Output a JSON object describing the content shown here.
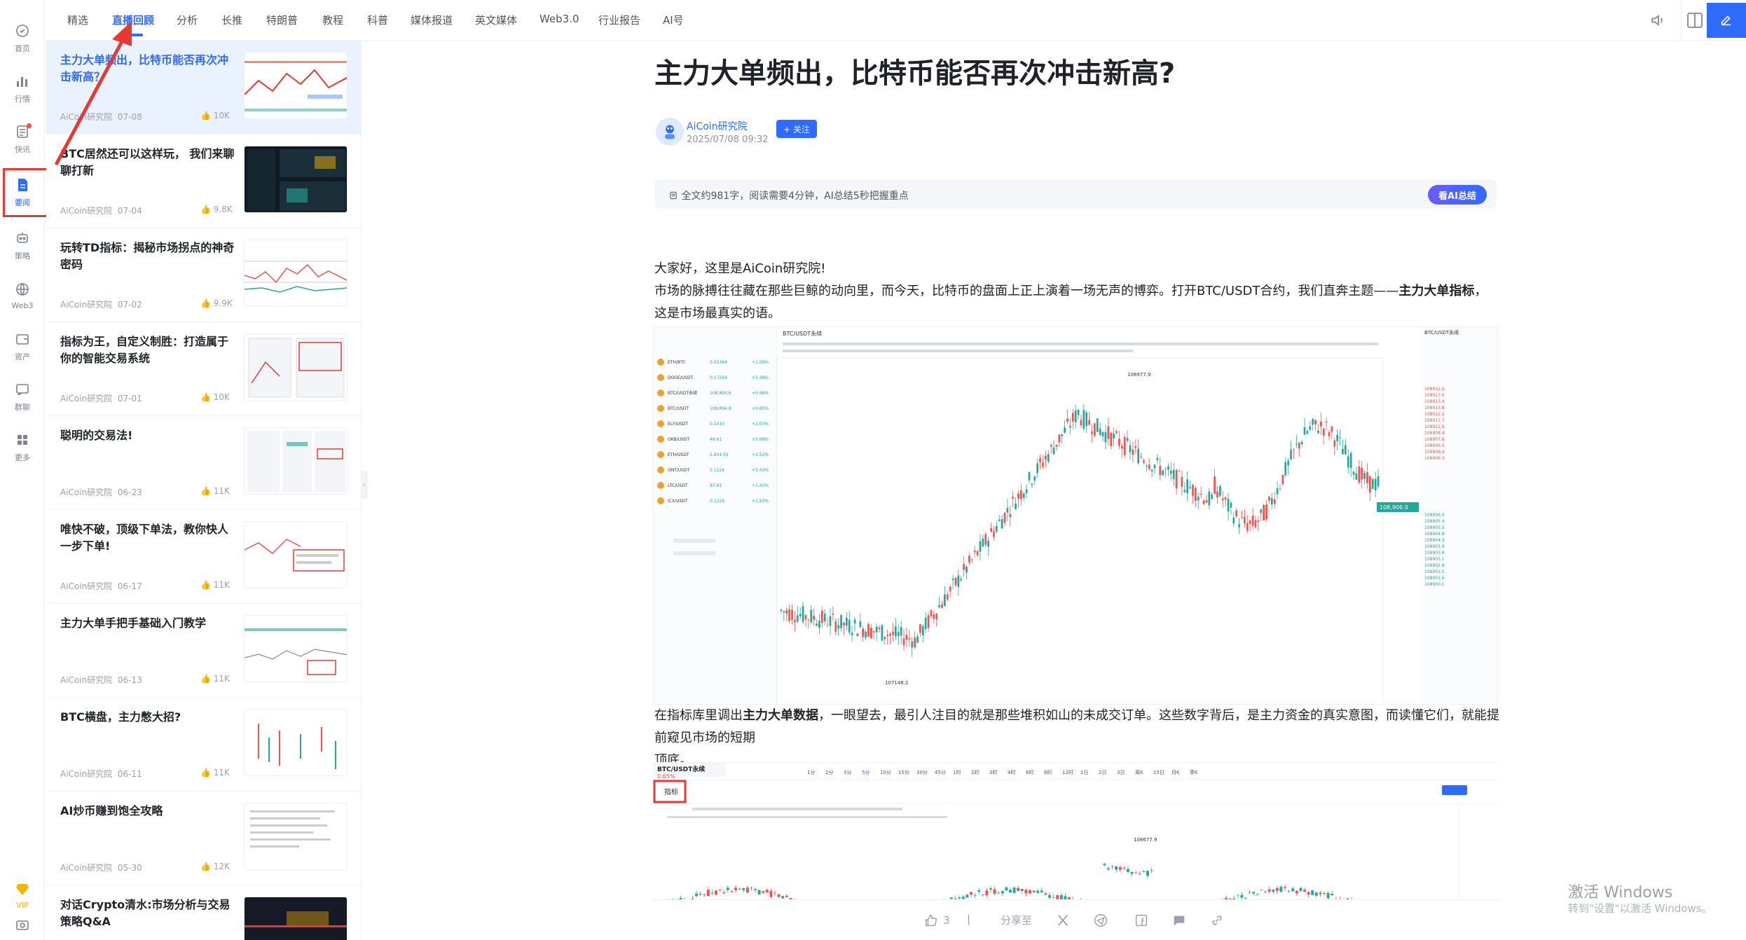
{
  "rail": {
    "items": [
      {
        "label": "首页",
        "icon": "home-icon"
      },
      {
        "label": "行情",
        "icon": "market-icon"
      },
      {
        "label": "快讯",
        "icon": "news-flash-icon"
      },
      {
        "label": "要闻",
        "icon": "headline-icon"
      },
      {
        "label": "策略",
        "icon": "strategy-icon"
      },
      {
        "label": "Web3",
        "icon": "web3-icon"
      },
      {
        "label": "资产",
        "icon": "wallet-icon"
      },
      {
        "label": "群聊",
        "icon": "chat-icon"
      },
      {
        "label": "更多",
        "icon": "more-grid-icon"
      },
      {
        "label": "VIP",
        "icon": "vip-diamond-icon"
      }
    ]
  },
  "topnav": {
    "tabs": [
      "精选",
      "直播回顾",
      "分析",
      "长推",
      "特朗普",
      "教程",
      "科普",
      "媒体报道",
      "英文媒体",
      "Web3.0",
      "行业报告",
      "AI号"
    ],
    "active": "直播回顾"
  },
  "list": {
    "items": [
      {
        "title": "主力大单频出，比特币能否再次冲击新高？",
        "author": "AiCoin研究院",
        "date": "07-08",
        "views": "10K"
      },
      {
        "title": "BTC居然还可以这样玩， 我们来聊聊打新",
        "author": "AiCoin研究院",
        "date": "07-04",
        "views": "9.8K"
      },
      {
        "title": "玩转TD指标：揭秘市场拐点的神奇密码",
        "author": "AiCoin研究院",
        "date": "07-02",
        "views": "9.9K"
      },
      {
        "title": "指标为王，自定义制胜：打造属于你的智能交易系统",
        "author": "AiCoin研究院",
        "date": "07-01",
        "views": "10K"
      },
      {
        "title": "聪明的交易法!",
        "author": "AiCoin研究院",
        "date": "06-23",
        "views": "11K"
      },
      {
        "title": "唯快不破，顶级下单法，教你快人一步下单!",
        "author": "AiCoin研究院",
        "date": "06-17",
        "views": "11K"
      },
      {
        "title": "主力大单手把手基础入门教学",
        "author": "AiCoin研究院",
        "date": "06-13",
        "views": "11K"
      },
      {
        "title": "BTC横盘，主力憋大招?",
        "author": "AiCoin研究院",
        "date": "06-11",
        "views": "11K"
      },
      {
        "title": "AI炒币赚到饱全攻略",
        "author": "AiCoin研究院",
        "date": "05-30",
        "views": "12K"
      },
      {
        "title": "对话Crypto清水:市场分析与交易策略Q&A",
        "author": "",
        "date": "",
        "views": ""
      }
    ]
  },
  "article": {
    "title": "主力大单频出，比特币能否再次冲击新高?",
    "author": "AiCoin研究院",
    "datetime": "2025/07/08 09:32",
    "follow_label": "+ 关注",
    "summary": "全文约981字，阅读需要4分钟，AI总结5秒把握重点",
    "ai_button": "看AI总结",
    "p1": "大家好，这里是AiCoin研究院!",
    "p2_a": "市场的脉搏往往藏在那些巨鲸的动向里，而今天，比特币的盘面上正上演着一场无声的博弈。打开BTC/USDT合约，我们直奔主题——",
    "p2_b": "主力大单指标",
    "p2_c": "，",
    "p2_d": "这是市场最真实的语。",
    "p3_a": "在指标库里调出",
    "p3_b": "主力大单数据",
    "p3_c": "，一眼望去，最引人注目的就是那些堆积如山的未成交订单。这些数字背后，是主力资金的真实意图，而读懂它们，就能提前窥见市场的短期",
    "p3_d": "顶底。"
  },
  "screenshot1": {
    "pair": "BTC/USDT永续",
    "price": "108,906.0",
    "high_label": "108977.9",
    "low_label": "107148.2",
    "watch": [
      {
        "sym": "ETH/BTC",
        "price": "0.02344",
        "chg": "+1.09%"
      },
      {
        "sym": "DOGE/USDT",
        "price": "0.17244",
        "chg": "+5.38%"
      },
      {
        "sym": "BTC/USDT永续",
        "price": "108,894.6",
        "chg": "+0.96%"
      },
      {
        "sym": "BTC/USDT",
        "price": "108,894.8",
        "chg": "+0.85%"
      },
      {
        "sym": "ELF/USDT",
        "price": "0.1410",
        "chg": "+2.03%"
      },
      {
        "sym": "OKB/USDT",
        "price": "48.61",
        "chg": "+5.08%"
      },
      {
        "sym": "ETH/USDT",
        "price": "2,604.55",
        "chg": "+2.52%"
      },
      {
        "sym": "ONT/USDT",
        "price": "0.1224",
        "chg": "+3.43%"
      },
      {
        "sym": "LTC/USDT",
        "price": "87.81",
        "chg": "+1.43%"
      },
      {
        "sym": "ICX/USDT",
        "price": "0.1229",
        "chg": "+1.53%"
      }
    ],
    "asks": [
      "108922.5",
      "108917.6",
      "108917.4",
      "108913.8",
      "108912.2",
      "108911.7",
      "108911.5",
      "108908.4",
      "108907.6",
      "108906.5",
      "108906.4",
      "108906.3"
    ],
    "bids": [
      "108906.0",
      "108905.4",
      "108905.3",
      "108904.8",
      "108904.3",
      "108903.9",
      "108903.6",
      "108903.1",
      "108902.8",
      "108902.5",
      "108901.6",
      "108900.1"
    ]
  },
  "screenshot2": {
    "pair": "BTC/USDT永续",
    "change": "0.65%",
    "indicator_btn": "指标",
    "peak": "108677.9",
    "timeframes": [
      "1分",
      "2分",
      "3分",
      "5分",
      "10分",
      "15分",
      "30分",
      "45分",
      "1时",
      "2时",
      "3时",
      "4时",
      "6时",
      "8时",
      "12时",
      "1日",
      "2日",
      "3日",
      "周K",
      "15日",
      "月K",
      "季K"
    ]
  },
  "actions": {
    "likes": "3",
    "share_label": "分享至"
  },
  "watermark": {
    "line1": "激活 Windows",
    "line2": "转到\"设置\"以激活 Windows。"
  },
  "colors": {
    "accent": "#2f6bff",
    "up": "#26a69a",
    "down": "#ef5350",
    "annotation": "#e53935"
  }
}
